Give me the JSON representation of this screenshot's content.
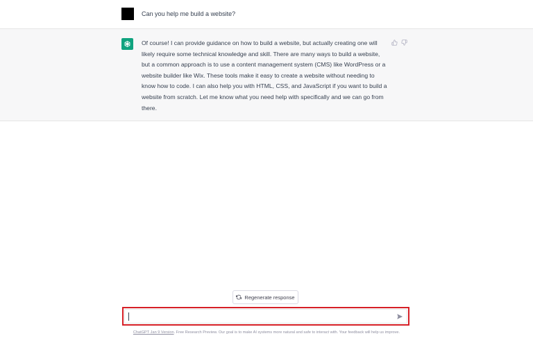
{
  "conversation": {
    "user_message": "Can you help me build a website?",
    "assistant_message": "Of course! I can provide guidance on how to build a website, but actually creating one will likely require some technical knowledge and skill. There are many ways to build a website, but a common approach is to use a content management system (CMS) like WordPress or a website builder like Wix. These tools make it easy to create a website without needing to know how to code. I can also help you with HTML, CSS, and JavaScript if you want to build a website from scratch. Let me know what you need help with specifically and we can go from there."
  },
  "icons": {
    "assistant_avatar": "openai-logo-icon",
    "thumbs_up": "thumbs-up-icon",
    "thumbs_down": "thumbs-down-icon",
    "regenerate": "refresh-icon",
    "send": "send-icon"
  },
  "colors": {
    "assistant_avatar_bg": "#10a37f",
    "user_avatar_bg": "#000000",
    "assistant_row_bg": "#f7f7f8",
    "input_highlight_border": "#d61f26"
  },
  "controls": {
    "regenerate_label": "Regenerate response",
    "input_value": "",
    "input_placeholder": ""
  },
  "footer": {
    "version_link": "ChatGPT Jan 9 Version",
    "text": ". Free Research Preview. Our goal is to make AI systems more natural and safe to interact with. Your feedback will help us improve."
  }
}
